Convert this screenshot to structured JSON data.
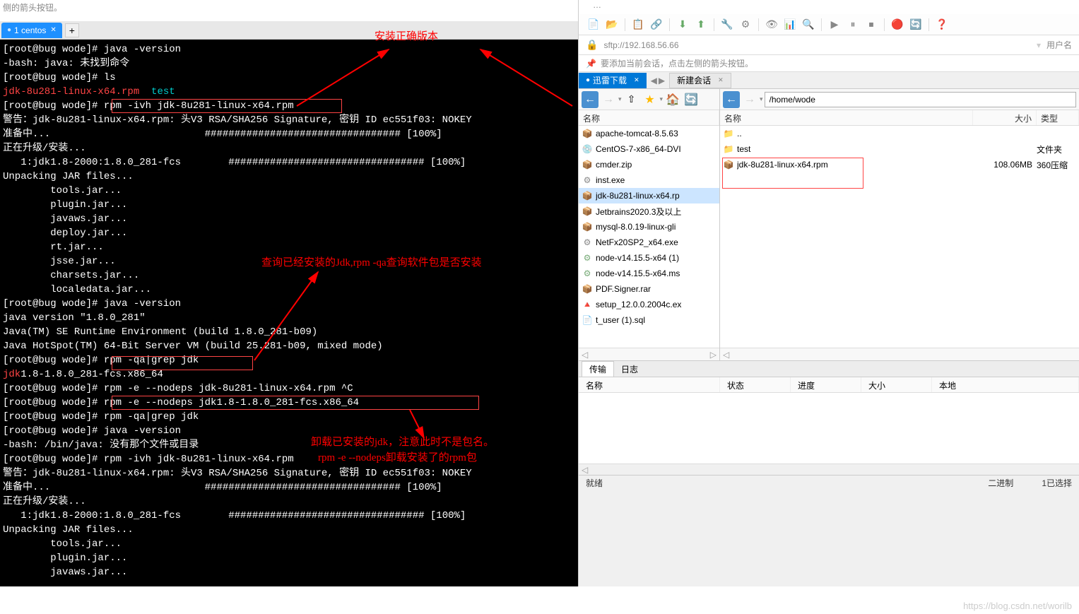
{
  "top_hint": "侧的箭头按钮。",
  "tab": {
    "label": "1 centos"
  },
  "annotations": {
    "install_correct": "安装正确版本",
    "query_installed": "查询已经安装的Jdk,rpm -qa查询软件包是否安装",
    "uninstall_line1": "卸载已安装的jdk，注意此时不是包名。",
    "uninstall_line2": "rpm -e --nodeps卸载安装了的rpm包"
  },
  "terminal_lines": [
    {
      "t": "[root@bug wode]# java -version"
    },
    {
      "t": "-bash: java: 未找到命令"
    },
    {
      "t": "[root@bug wode]# ls"
    },
    {
      "t": "jdk-8u281-linux-x64.rpm  test",
      "special": "lsout"
    },
    {
      "t": "[root@bug wode]# rpm -ivh jdk-8u281-linux-x64.rpm"
    },
    {
      "t": "警告：jdk-8u281-linux-x64.rpm: 头V3 RSA/SHA256 Signature, 密钥 ID ec551f03: NOKEY"
    },
    {
      "t": "准备中...                          ################################# [100%]"
    },
    {
      "t": "正在升级/安装..."
    },
    {
      "t": "   1:jdk1.8-2000:1.8.0_281-fcs        ################################# [100%]"
    },
    {
      "t": "Unpacking JAR files..."
    },
    {
      "t": "        tools.jar..."
    },
    {
      "t": "        plugin.jar..."
    },
    {
      "t": "        javaws.jar..."
    },
    {
      "t": "        deploy.jar..."
    },
    {
      "t": "        rt.jar..."
    },
    {
      "t": "        jsse.jar..."
    },
    {
      "t": "        charsets.jar..."
    },
    {
      "t": "        localedata.jar..."
    },
    {
      "t": "[root@bug wode]# java -version"
    },
    {
      "t": "java version \"1.8.0_281\""
    },
    {
      "t": "Java(TM) SE Runtime Environment (build 1.8.0_281-b09)"
    },
    {
      "t": "Java HotSpot(TM) 64-Bit Server VM (build 25.281-b09, mixed mode)"
    },
    {
      "t": "[root@bug wode]# rpm -qa|grep jdk"
    },
    {
      "t": "jdk1.8-1.8.0_281-fcs.x86_64",
      "special": "red3"
    },
    {
      "t": "[root@bug wode]# rpm -e --nodeps jdk-8u281-linux-x64.rpm ^C"
    },
    {
      "t": "[root@bug wode]# rpm -e --nodeps jdk1.8-1.8.0_281-fcs.x86_64"
    },
    {
      "t": "[root@bug wode]# rpm -qa|grep jdk"
    },
    {
      "t": "[root@bug wode]# java -version"
    },
    {
      "t": "-bash: /bin/java: 没有那个文件或目录"
    },
    {
      "t": "[root@bug wode]# rpm -ivh jdk-8u281-linux-x64.rpm"
    },
    {
      "t": "警告：jdk-8u281-linux-x64.rpm: 头V3 RSA/SHA256 Signature, 密钥 ID ec551f03: NOKEY"
    },
    {
      "t": "准备中...                          ################################# [100%]"
    },
    {
      "t": "正在升级/安装..."
    },
    {
      "t": "   1:jdk1.8-2000:1.8.0_281-fcs        ################################# [100%]"
    },
    {
      "t": "Unpacking JAR files..."
    },
    {
      "t": "        tools.jar..."
    },
    {
      "t": "        plugin.jar..."
    },
    {
      "t": "        javaws.jar..."
    }
  ],
  "address": "sftp://192.168.56.66",
  "user_label": "用户名",
  "hint_text": "要添加当前会话，点击左侧的箭头按钮。",
  "session_tabs": {
    "active": "迅雷下载",
    "new": "新建会话"
  },
  "remote_path": "/home/wode",
  "list_headers": {
    "name": "名称",
    "size": "大小",
    "type": "类型"
  },
  "local_files": [
    {
      "name": "apache-tomcat-8.5.63",
      "ic": "📦",
      "color": "#c90"
    },
    {
      "name": "CentOS-7-x86_64-DVI",
      "ic": "💿",
      "color": "#888"
    },
    {
      "name": "cmder.zip",
      "ic": "📦",
      "color": "#c90"
    },
    {
      "name": "inst.exe",
      "ic": "⚙",
      "color": "#888"
    },
    {
      "name": "jdk-8u281-linux-x64.rp",
      "ic": "📦",
      "color": "#c90",
      "selected": true
    },
    {
      "name": "Jetbrains2020.3及以上",
      "ic": "📦",
      "color": "#c90"
    },
    {
      "name": "mysql-8.0.19-linux-gli",
      "ic": "📦",
      "color": "#c90"
    },
    {
      "name": "NetFx20SP2_x64.exe",
      "ic": "⚙",
      "color": "#888"
    },
    {
      "name": "node-v14.15.5-x64 (1)",
      "ic": "⚙",
      "color": "#7a7"
    },
    {
      "name": "node-v14.15.5-x64.ms",
      "ic": "⚙",
      "color": "#7a7"
    },
    {
      "name": "PDF.Signer.rar",
      "ic": "📦",
      "color": "#c90"
    },
    {
      "name": "setup_12.0.0.2004c.ex",
      "ic": "🔺",
      "color": "#4a4"
    },
    {
      "name": "t_user (1).sql",
      "ic": "📄",
      "color": "#5af"
    }
  ],
  "remote_files": [
    {
      "name": "..",
      "ic": "📁",
      "size": "",
      "type": ""
    },
    {
      "name": "test",
      "ic": "📁",
      "size": "",
      "type": "文件夹"
    },
    {
      "name": "jdk-8u281-linux-x64.rpm",
      "ic": "📦",
      "size": "108.06MB",
      "type": "360压缩"
    }
  ],
  "transfer": {
    "tab1": "传输",
    "tab2": "日志",
    "col_name": "名称",
    "col_status": "状态",
    "col_progress": "进度",
    "col_size": "大小",
    "col_local": "本地"
  },
  "status": {
    "ready": "就绪",
    "binary": "二进制",
    "selected": "1已选择"
  },
  "watermark": "https://blog.csdn.net/worilb"
}
